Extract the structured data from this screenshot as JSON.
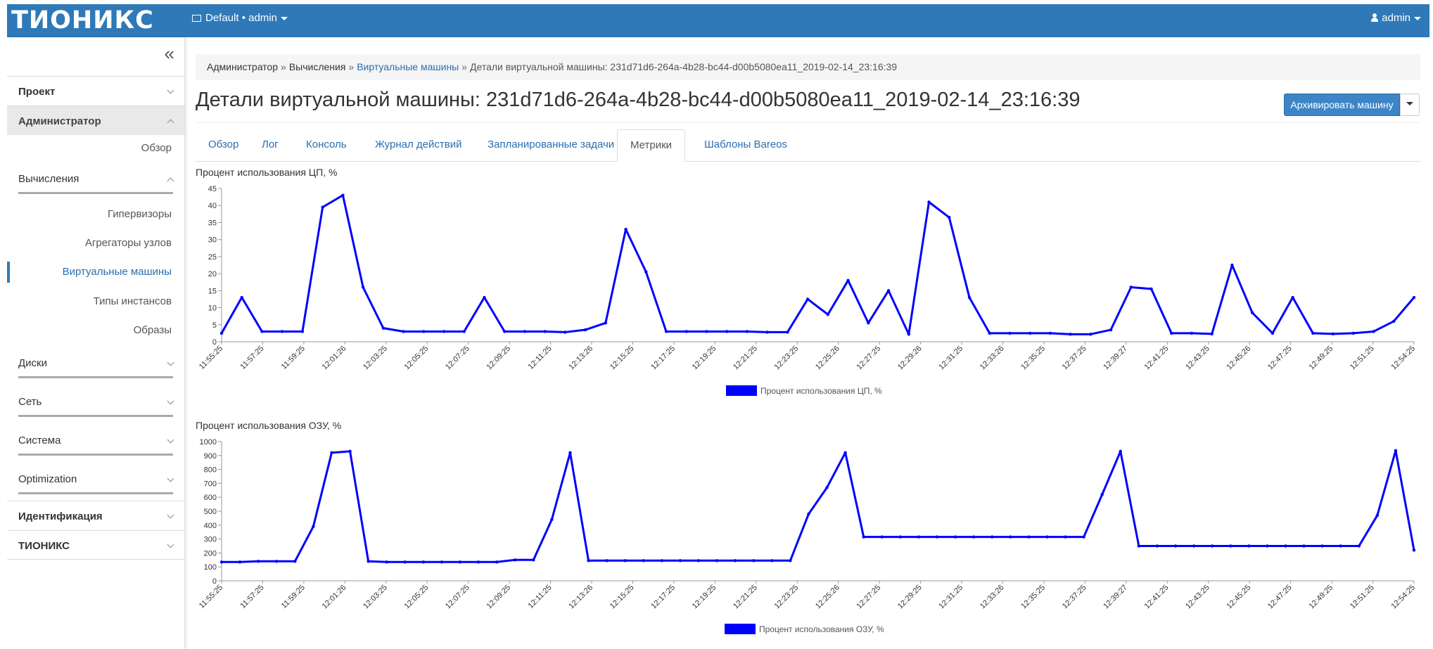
{
  "app": {
    "brand": "ТИОНИКС",
    "project_selector": "Default • admin",
    "user_menu": "admin"
  },
  "sidebar": {
    "sections": [
      {
        "label": "Проект",
        "expanded": false
      },
      {
        "label": "Администратор",
        "expanded": true
      },
      {
        "label": "Идентификация",
        "expanded": false
      },
      {
        "label": "ТИОНИКС",
        "expanded": false
      }
    ],
    "admin_overview": "Обзор",
    "compute": {
      "label": "Вычисления",
      "items": [
        "Гипервизоры",
        "Агрегаторы узлов",
        "Виртуальные машины",
        "Типы инстансов",
        "Образы"
      ],
      "active_item": "Виртуальные машины"
    },
    "groups": [
      "Диски",
      "Сеть",
      "Система",
      "Optimization"
    ]
  },
  "breadcrumb": {
    "items": [
      "Администратор",
      "Вычисления",
      "Виртуальные машины",
      "Детали виртуальной машины: 231d71d6-264a-4b28-bc44-d00b5080ea11_2019-02-14_23:16:39"
    ]
  },
  "page": {
    "title": "Детали виртуальной машины: 231d71d6-264a-4b28-bc44-d00b5080ea11_2019-02-14_23:16:39",
    "archive_button": "Архивировать машину"
  },
  "tabs": {
    "items": [
      "Обзор",
      "Лог",
      "Консоль",
      "Журнал действий",
      "Запланированные задачи",
      "Метрики",
      "Шаблоны Bareos"
    ],
    "active": "Метрики"
  },
  "chart_data": [
    {
      "type": "line",
      "title": "Процент использования ЦП, %",
      "legend": "Процент использования ЦП, %",
      "legend_placement": "bottom-center",
      "color": "#0000ff",
      "ylim": [
        0,
        45
      ],
      "yticks": [
        0,
        5,
        10,
        15,
        20,
        25,
        30,
        35,
        40,
        45
      ],
      "xticks": [
        "11:55:25",
        "11:57:25",
        "11:59:25",
        "12:01:26",
        "12:03:25",
        "12:05:25",
        "12:07:25",
        "12:09:25",
        "12:11:25",
        "12:13:26",
        "12:15:25",
        "12:17:25",
        "12:19:25",
        "12:21:25",
        "12:23:25",
        "12:25:26",
        "12:27:25",
        "12:29:26",
        "12:31:25",
        "12:33:26",
        "12:35:25",
        "12:37:25",
        "12:39:27",
        "12:41:25",
        "12:43:25",
        "12:45:26",
        "12:47:25",
        "12:49:25",
        "12:51:25",
        "12:54:25"
      ],
      "values": [
        2.5,
        13,
        3,
        3,
        3,
        39.5,
        43,
        16,
        4,
        3,
        3,
        3,
        3,
        13,
        3,
        3,
        3,
        2.8,
        3.5,
        5.5,
        33,
        20.5,
        3,
        3,
        3,
        3,
        3,
        2.8,
        2.8,
        12.5,
        8,
        18,
        5.5,
        15,
        2.2,
        41,
        36.5,
        13,
        2.5,
        2.5,
        2.5,
        2.5,
        2.2,
        2.2,
        3.5,
        16,
        15.5,
        2.5,
        2.5,
        2.3,
        22.5,
        8.5,
        2.5,
        13,
        2.5,
        2.3,
        2.5,
        3,
        6,
        13
      ]
    },
    {
      "type": "line",
      "title": "Процент использования ОЗУ, %",
      "legend": "Процент использования ОЗУ, %",
      "legend_placement": "bottom-center",
      "color": "#0000ff",
      "ylim": [
        0,
        1000
      ],
      "yticks": [
        0,
        100,
        200,
        300,
        400,
        500,
        600,
        700,
        800,
        900,
        1000
      ],
      "xticks": [
        "11:55:25",
        "11:57:25",
        "11:59:25",
        "12:01:26",
        "12:03:25",
        "12:05:25",
        "12:07:25",
        "12:09:25",
        "12:11:25",
        "12:13:26",
        "12:15:25",
        "12:17:25",
        "12:19:25",
        "12:21:25",
        "12:23:25",
        "12:25:26",
        "12:27:25",
        "12:29:25",
        "12:31:25",
        "12:33:26",
        "12:35:25",
        "12:37:25",
        "12:39:27",
        "12:41:25",
        "12:43:25",
        "12:45:25",
        "12:47:25",
        "12:49:25",
        "12:51:25",
        "12:54:25"
      ],
      "values": [
        135,
        135,
        140,
        140,
        140,
        390,
        920,
        930,
        140,
        135,
        135,
        135,
        135,
        135,
        135,
        135,
        150,
        150,
        440,
        920,
        145,
        145,
        145,
        145,
        145,
        145,
        145,
        145,
        145,
        145,
        145,
        145,
        480,
        670,
        920,
        315,
        315,
        315,
        315,
        315,
        315,
        315,
        315,
        315,
        315,
        315,
        315,
        315,
        620,
        930,
        250,
        250,
        250,
        250,
        250,
        250,
        250,
        250,
        250,
        250,
        250,
        250,
        250,
        470,
        935,
        220
      ]
    }
  ]
}
